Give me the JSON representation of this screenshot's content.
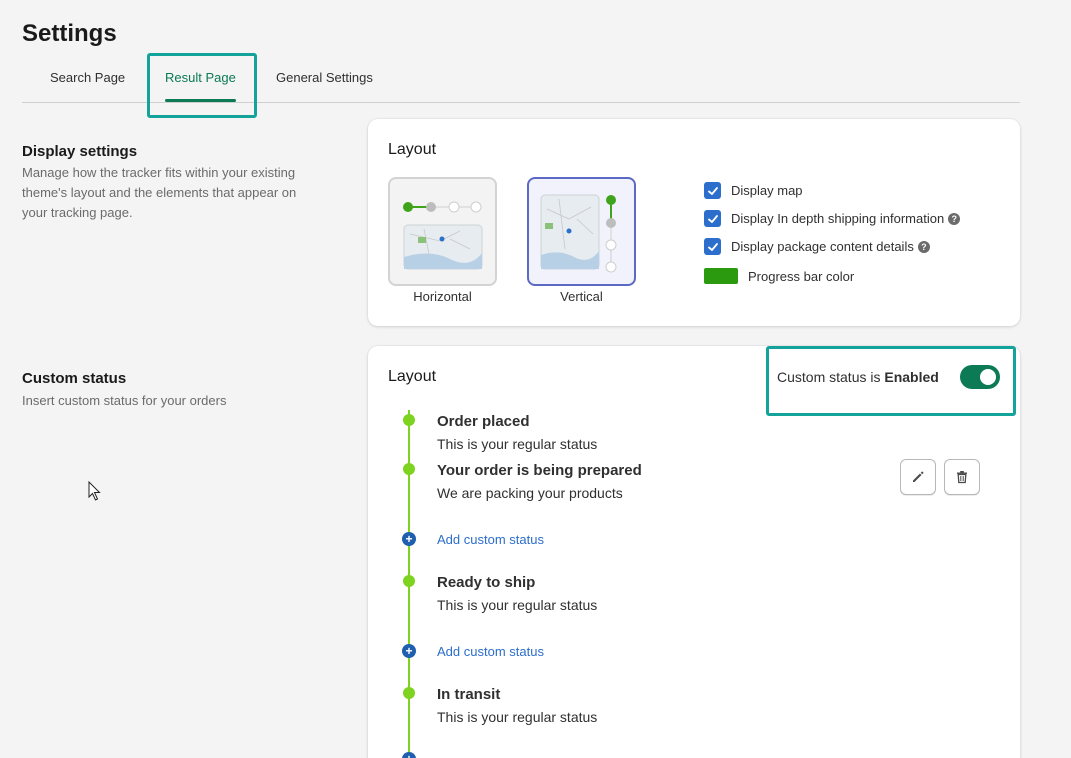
{
  "page": {
    "title": "Settings"
  },
  "tabs": [
    {
      "label": "Search Page"
    },
    {
      "label": "Result Page"
    },
    {
      "label": "General Settings"
    }
  ],
  "display_settings": {
    "title": "Display settings",
    "description_lines": [
      "Manage how the tracker fits within your existing",
      "theme's layout and the elements that appear on",
      "your tracking page."
    ],
    "card_title": "Layout",
    "layout_options": [
      {
        "label": "Horizontal",
        "selected": false
      },
      {
        "label": "Vertical",
        "selected": true
      }
    ],
    "checkboxes": [
      {
        "label": "Display map",
        "checked": true,
        "help": false
      },
      {
        "label": "Display In depth shipping information",
        "checked": true,
        "help": true
      },
      {
        "label": "Display package content details",
        "checked": true,
        "help": true
      }
    ],
    "progress_color": {
      "label": "Progress bar color",
      "value": "#2c9a0f"
    }
  },
  "custom_status": {
    "title": "Custom status",
    "description": "Insert custom status for your orders",
    "card_title": "Layout",
    "toggle_prefix": "Custom status is",
    "toggle_state": "Enabled",
    "enabled": true,
    "add_label": "Add custom status",
    "statuses": [
      {
        "name": "Order placed",
        "desc": "This is your regular status"
      },
      {
        "name": "Your order is being prepared",
        "desc": "We are packing your products"
      },
      {
        "name": "Ready to ship",
        "desc": "This is your regular status"
      },
      {
        "name": "In transit",
        "desc": "This is your regular status"
      }
    ]
  },
  "colors": {
    "accent": "#0b7a55",
    "highlight": "#13a39a",
    "timeline": "#7ed321",
    "link": "#2c6ecb"
  },
  "icons": {
    "edit": "pencil-icon",
    "delete": "trash-icon",
    "add": "plus-circle-icon",
    "help": "help-icon",
    "check": "check-icon"
  }
}
